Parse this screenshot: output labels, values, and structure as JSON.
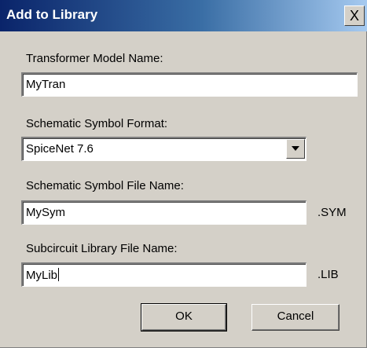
{
  "window": {
    "title": "Add to Library",
    "close_glyph": "X"
  },
  "form": {
    "model_name": {
      "label": "Transformer Model Name:",
      "value": "MyTran"
    },
    "symbol_format": {
      "label": "Schematic Symbol Format:",
      "selected": "SpiceNet 7.6"
    },
    "symbol_file": {
      "label": "Schematic Symbol File Name:",
      "value": "MySym",
      "extension": ".SYM"
    },
    "library_file": {
      "label": "Subcircuit Library File Name:",
      "value": "MyLib",
      "extension": ".LIB"
    }
  },
  "buttons": {
    "ok": "OK",
    "cancel": "Cancel"
  },
  "colors": {
    "title_bar_start": "#0a246a",
    "title_bar_end": "#a6caf0",
    "dialog_face": "#d4d0c8"
  },
  "icons": {
    "dropdown": "chevron-down-icon",
    "close": "close-icon"
  }
}
